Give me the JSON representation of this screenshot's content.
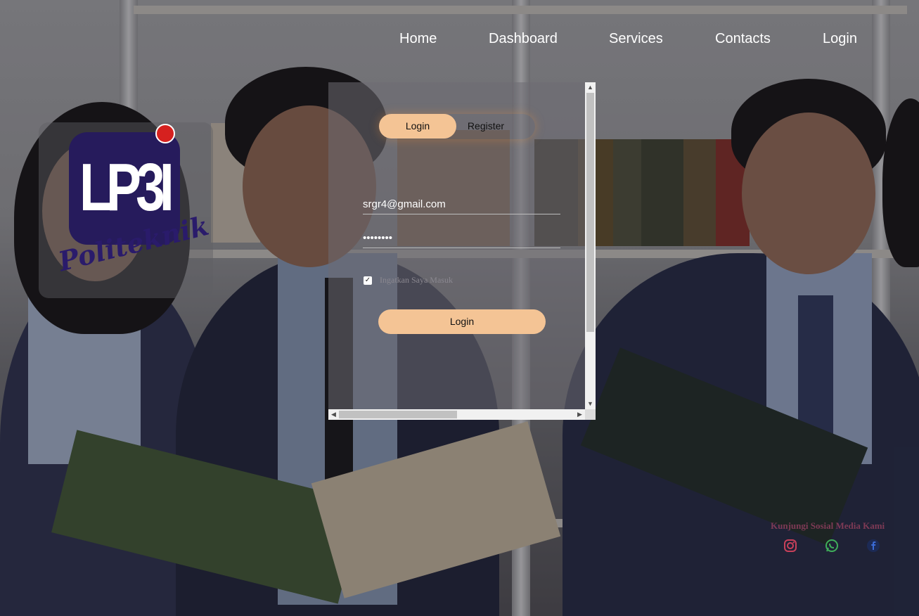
{
  "nav": {
    "home": "Home",
    "dashboard": "Dashboard",
    "services": "Services",
    "contacts": "Contacts",
    "login": "Login"
  },
  "logo": {
    "mark": "LP3I",
    "tagline": "Politeknik",
    "accent_color": "#261b5c",
    "dot_color": "#d6211f"
  },
  "auth": {
    "tabs": {
      "login": "Login",
      "register": "Register"
    },
    "email_value": "srgr4@gmail.com",
    "password_value": "••••••••",
    "remember_label": "Ingatkan Saya Masuk",
    "remember_checked": true,
    "submit_label": "Login",
    "button_color": "#f4c495"
  },
  "social": {
    "title": "Kunjungi Sosial Media Kami",
    "icons": [
      "instagram-icon",
      "whatsapp-icon",
      "facebook-icon"
    ]
  }
}
